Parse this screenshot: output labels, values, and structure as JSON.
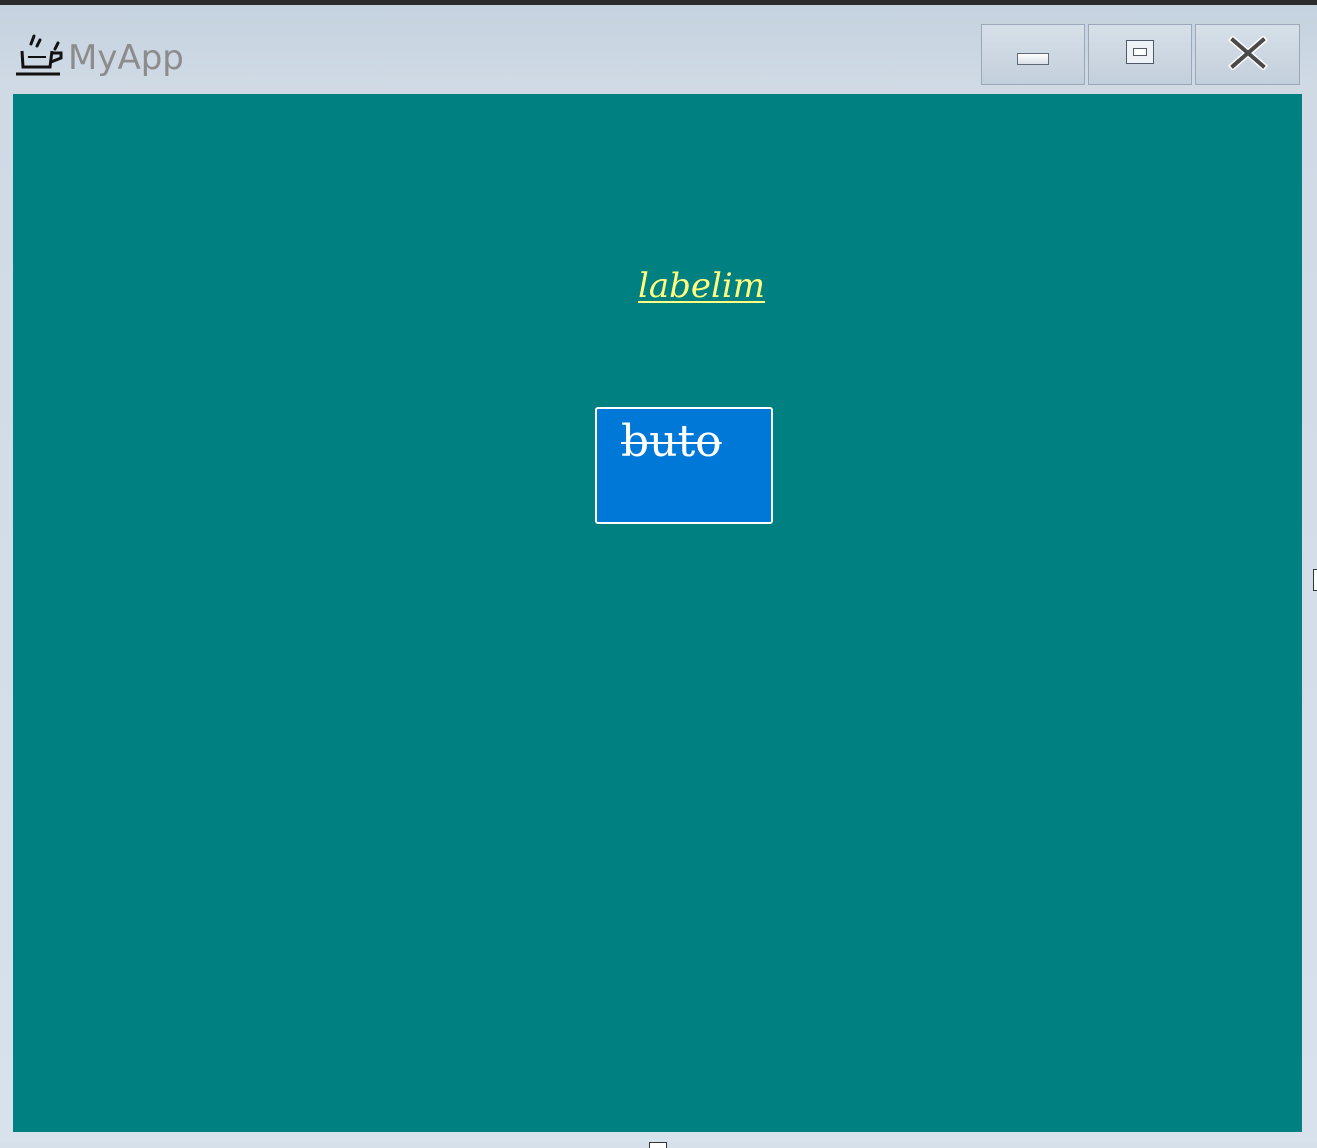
{
  "window": {
    "title": "MyApp",
    "icon": "coffee-cup-icon",
    "controls": {
      "minimize_icon": "minimize-icon",
      "maximize_icon": "maximize-icon",
      "close_icon": "close-icon"
    }
  },
  "content": {
    "background_color": "#008080",
    "label": {
      "text": "labelim",
      "color": "#ffff80"
    },
    "button": {
      "text": "buto",
      "background_color": "#0078d7",
      "text_color": "#ffffff"
    }
  }
}
